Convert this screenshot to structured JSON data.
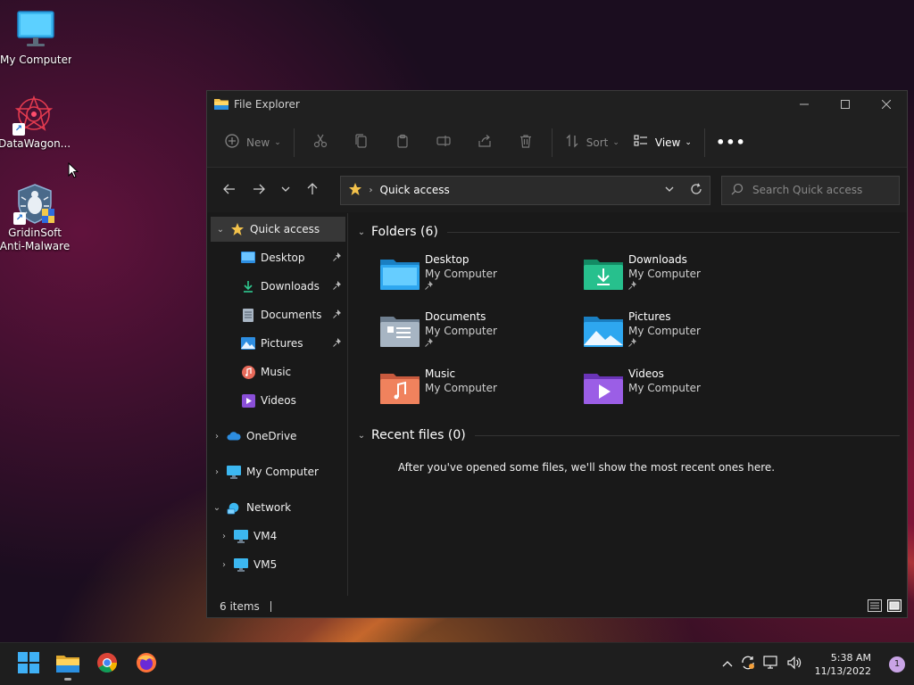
{
  "desktop": {
    "icons": [
      {
        "label": "My Computer"
      },
      {
        "label": "DataWagon..."
      },
      {
        "label": "GridinSoft Anti-Malware"
      }
    ]
  },
  "window": {
    "title": "File Explorer"
  },
  "toolbar": {
    "new_label": "New",
    "sort_label": "Sort",
    "view_label": "View"
  },
  "address": {
    "crumb": "Quick access"
  },
  "search": {
    "placeholder": "Search Quick access"
  },
  "nav": {
    "quick_access": "Quick access",
    "pinned": [
      {
        "label": "Desktop"
      },
      {
        "label": "Downloads"
      },
      {
        "label": "Documents"
      },
      {
        "label": "Pictures"
      },
      {
        "label": "Music"
      },
      {
        "label": "Videos"
      }
    ],
    "onedrive": "OneDrive",
    "my_computer": "My Computer",
    "network": "Network",
    "network_items": [
      {
        "label": "VM4"
      },
      {
        "label": "VM5"
      }
    ]
  },
  "content": {
    "folders_header": "Folders (6)",
    "folders": [
      {
        "name": "Desktop",
        "location": "My Computer"
      },
      {
        "name": "Downloads",
        "location": "My Computer"
      },
      {
        "name": "Documents",
        "location": "My Computer"
      },
      {
        "name": "Pictures",
        "location": "My Computer"
      },
      {
        "name": "Music",
        "location": "My Computer"
      },
      {
        "name": "Videos",
        "location": "My Computer"
      }
    ],
    "recent_header": "Recent files (0)",
    "recent_empty": "After you've opened some files, we'll show the most recent ones here."
  },
  "status": {
    "items": "6 items"
  },
  "taskbar": {
    "time": "5:38 AM",
    "date": "11/13/2022",
    "notifications": "1"
  },
  "colors": {
    "accent": "#0078d4",
    "folder_yellow": "#f3c24b",
    "window_bg": "#191919"
  }
}
